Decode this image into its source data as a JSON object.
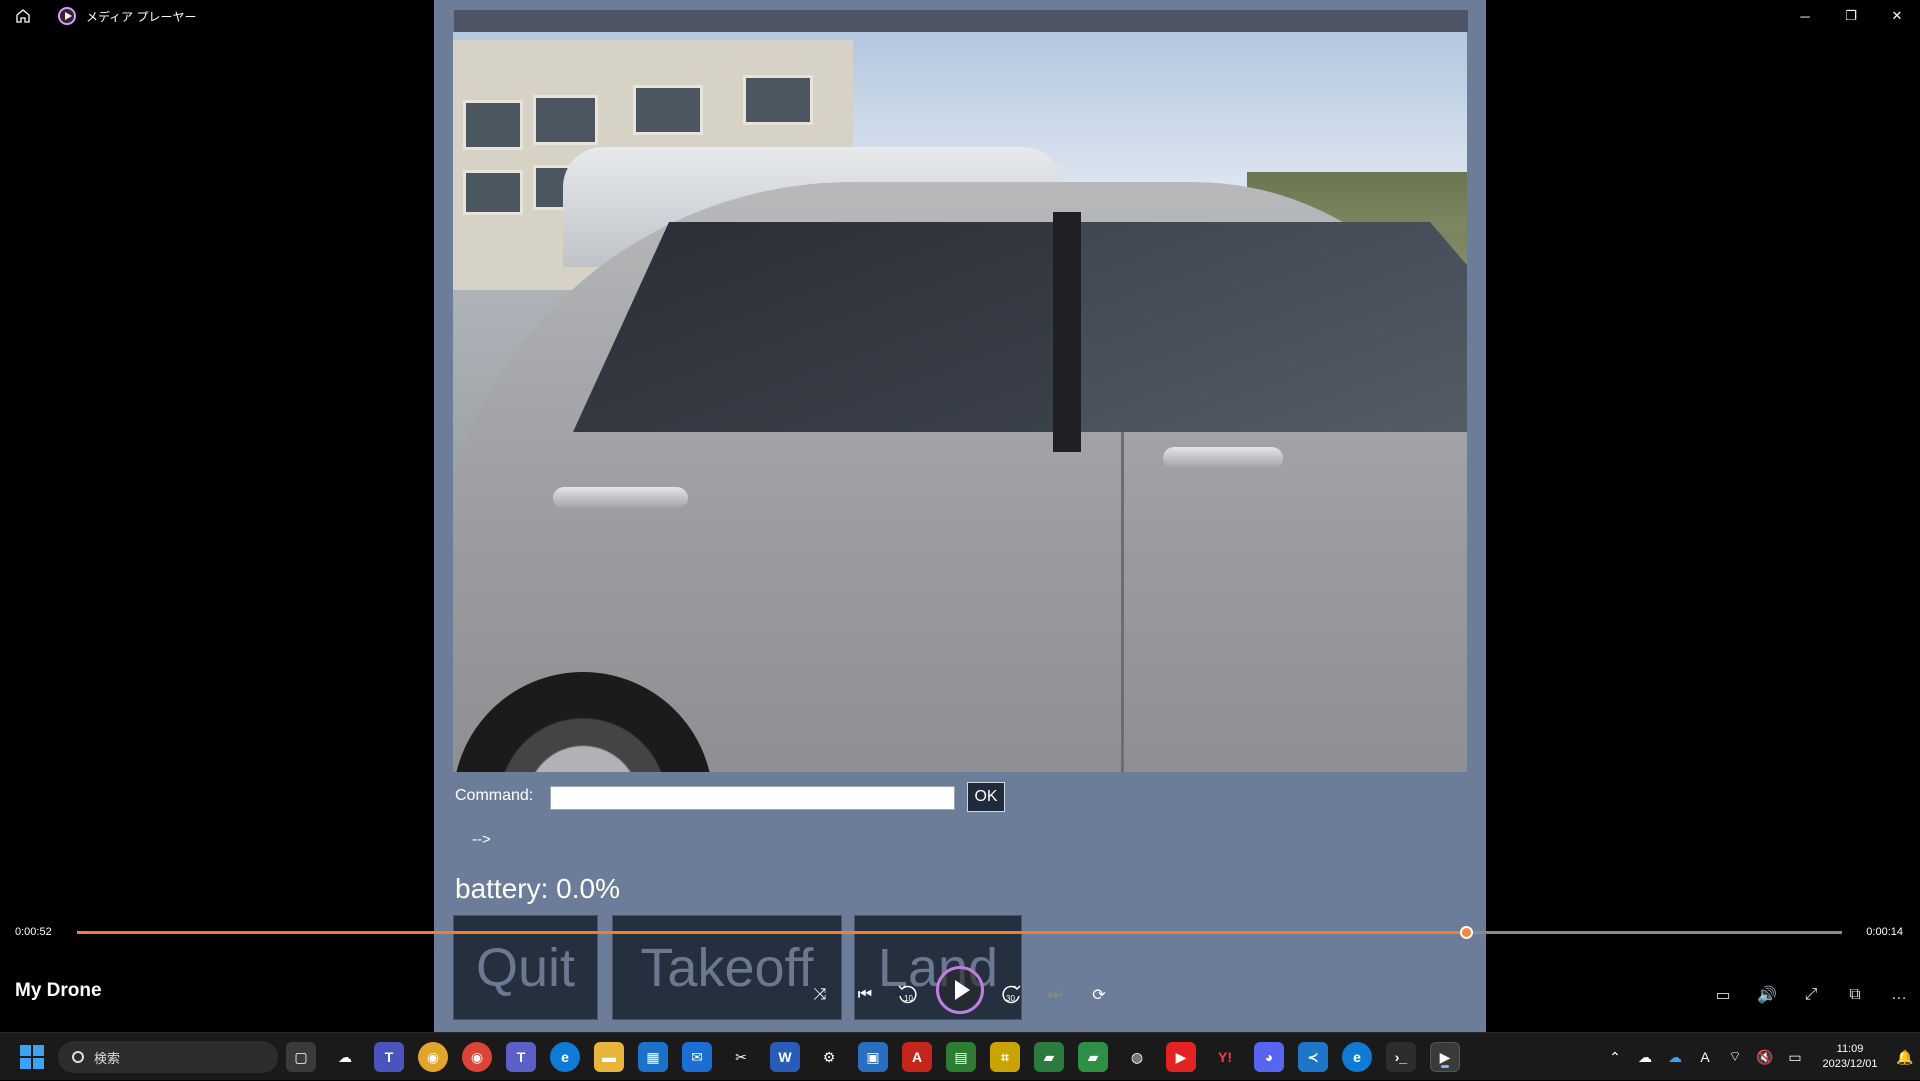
{
  "titlebar": {
    "title": "メディア プレーヤー",
    "minimize": "─",
    "restore": "❐",
    "close": "✕"
  },
  "app": {
    "command_label": "Command:",
    "command_value": "",
    "ok_label": "OK",
    "arrow_text": "-->",
    "battery_text": "battery: 0.0%",
    "buttons": {
      "quit": "Quit",
      "takeoff": "Takeoff",
      "land": "Land"
    }
  },
  "player": {
    "elapsed": "0:00:52",
    "remaining": "0:00:14",
    "progress_fraction": 0.787,
    "title": "My Drone",
    "accent_color": "#f08030",
    "controls": {
      "shuffle": "⤨",
      "previous": "⏮",
      "rewind": "10",
      "forward": "30",
      "next": "⏭",
      "repeat": "⟳"
    },
    "right_controls": {
      "captions": "▭",
      "volume": "🔊",
      "fullscreen": "⤢",
      "miniplayer": "⧉",
      "more": "…"
    }
  },
  "taskbar": {
    "search_placeholder": "検索",
    "clock_time": "11:09",
    "clock_date": "2023/12/01",
    "ime": "A"
  }
}
